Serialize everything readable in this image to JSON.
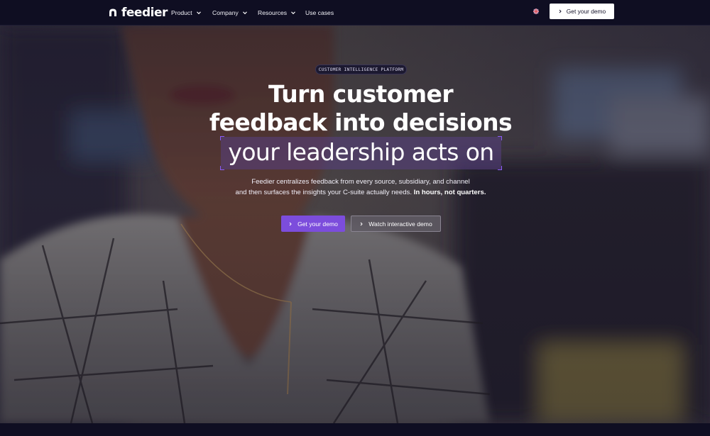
{
  "brand": {
    "name": "feedier"
  },
  "nav": {
    "items": [
      {
        "label": "Product",
        "has_dropdown": true
      },
      {
        "label": "Company",
        "has_dropdown": true
      },
      {
        "label": "Resources",
        "has_dropdown": true
      },
      {
        "label": "Use cases",
        "has_dropdown": false
      }
    ],
    "language_icon": "uk-flag-icon",
    "cta_label": "Get your demo"
  },
  "hero": {
    "badge": "CUSTOMER INTELLIGENCE PLATFORM",
    "headline_line1": "Turn customer",
    "headline_line2": "feedback into decisions",
    "headline_accent": "your leadership acts on",
    "subtext_line1": "Feedier centralizes feedback from every source, subsidiary, and channel",
    "subtext_line2": "and then surfaces the insights your C-suite actually needs.",
    "subtext_bold": "In hours, not quarters.",
    "primary_button": "Get your demo",
    "secondary_button": "Watch interactive demo"
  },
  "colors": {
    "nav_bg": "#0f0e22",
    "accent": "#7c4ddc",
    "highlight_corner": "#8b5cf6",
    "text": "#ffffff"
  }
}
